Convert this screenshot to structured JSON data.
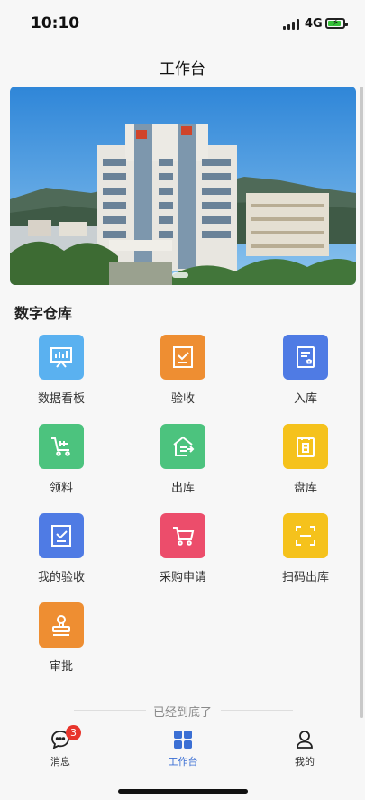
{
  "status_bar": {
    "time": "10:10",
    "network": "4G"
  },
  "header": {
    "title": "工作台"
  },
  "section": {
    "title": "数字仓库"
  },
  "grid": [
    {
      "label": "数据看板",
      "icon": "dashboard-icon",
      "color": "#5ab1f0"
    },
    {
      "label": "验收",
      "icon": "check-clipboard-icon",
      "color": "#ee8e32"
    },
    {
      "label": "入库",
      "icon": "inbound-document-icon",
      "color": "#4f7be4"
    },
    {
      "label": "领料",
      "icon": "material-cart-icon",
      "color": "#4cc37e"
    },
    {
      "label": "出库",
      "icon": "warehouse-out-icon",
      "color": "#4cc37e"
    },
    {
      "label": "盘库",
      "icon": "inventory-calendar-icon",
      "color": "#f5c21c"
    },
    {
      "label": "我的验收",
      "icon": "my-check-icon",
      "color": "#4f7be4"
    },
    {
      "label": "采购申请",
      "icon": "shopping-cart-icon",
      "color": "#ec4d6b"
    },
    {
      "label": "扫码出库",
      "icon": "scan-icon",
      "color": "#f5c21c"
    },
    {
      "label": "审批",
      "icon": "approval-stamp-icon",
      "color": "#ee8e32"
    }
  ],
  "footer": {
    "end_text": "已经到底了"
  },
  "tabs": [
    {
      "label": "消息",
      "icon": "message-icon",
      "badge": "3"
    },
    {
      "label": "工作台",
      "icon": "workbench-icon",
      "active": true
    },
    {
      "label": "我的",
      "icon": "profile-icon"
    }
  ],
  "colors": {
    "accent": "#3b6fd4",
    "badge": "#e8352c"
  }
}
